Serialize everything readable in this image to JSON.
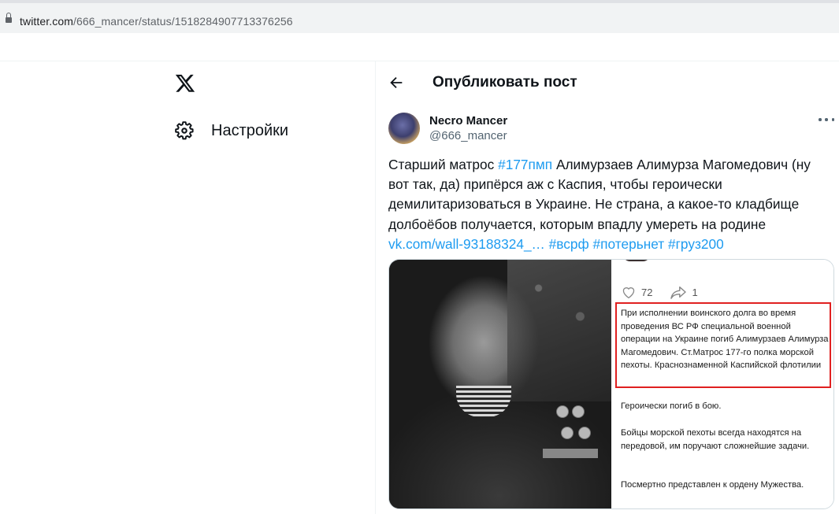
{
  "browser": {
    "url_host": "twitter.com",
    "url_path": "/666_mancer/status/1518284907713376256"
  },
  "sidebar": {
    "logo": "x-logo-icon",
    "settings_label": "Настройки"
  },
  "header": {
    "back_icon": "arrow-left-icon",
    "title": "Опубликовать пост"
  },
  "tweet": {
    "author_name": "Necro Mancer",
    "author_handle": "@666_mancer",
    "text_parts": {
      "t1": "Старший матрос ",
      "h1": "#177пмп",
      "t2": " Алимурзаев Алимурза Магомедович (ну вот так, да) припёрся аж с Каспия, чтобы героически демилитаризоваться в Украине. Не страна, а какое-то кладбище долбоёбов получается, которым впадлу умереть на родине ",
      "link": "vk.com/wall-93188324_…",
      "h2": "#всрф",
      "h3": "#потерьнет",
      "h4": "#груз200"
    }
  },
  "media": {
    "likes": "72",
    "shares": "1",
    "highlight_color": "#e02020",
    "paragraphs": [
      "При исполнении воинского долга во время проведения ВС РФ специальной военной операции на Украине погиб Алимурзаев Алимурза Магомедович. Ст.Матрос 177-го полка морской пехоты. Краснознаменной Каспийской флотилии",
      "Героически погиб в бою.",
      "Бойцы морской пехоты всегда находятся на передовой, им поручают сложнейшие задачи.",
      "Посмертно представлен к ордену Мужества."
    ]
  },
  "colors": {
    "link": "#1d9bf0",
    "text": "#0f1419",
    "muted": "#536471"
  }
}
